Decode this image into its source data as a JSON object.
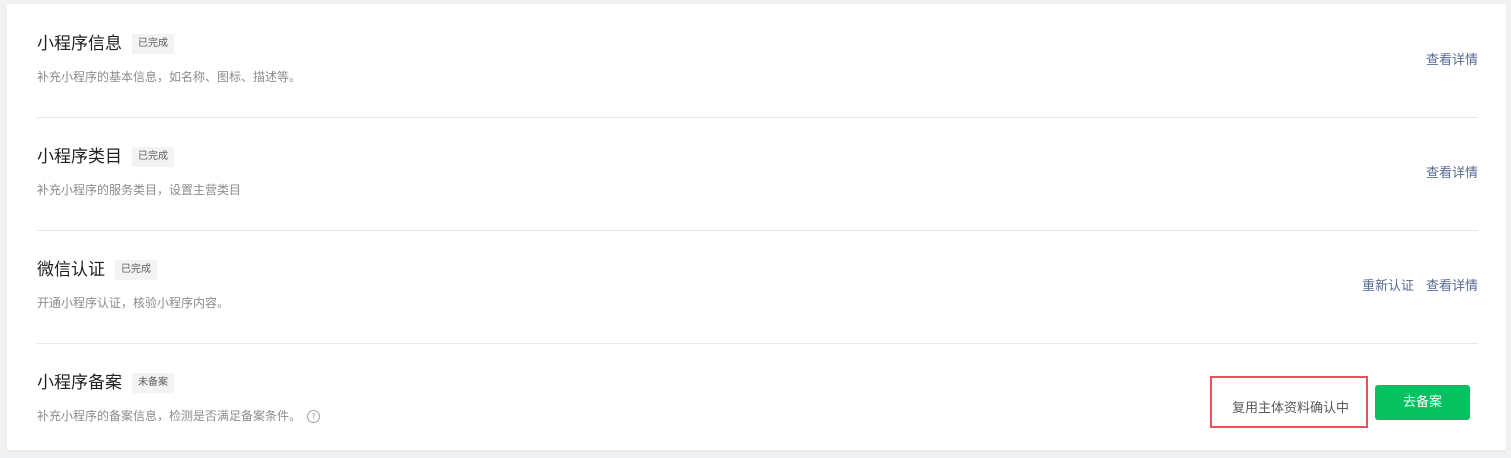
{
  "rows": [
    {
      "title": "小程序信息",
      "badge": "已完成",
      "desc": "补充小程序的基本信息，如名称、图标、描述等。",
      "actions": [
        "查看详情"
      ]
    },
    {
      "title": "小程序类目",
      "badge": "已完成",
      "desc": "补充小程序的服务类目，设置主营类目",
      "actions": [
        "查看详情"
      ]
    },
    {
      "title": "微信认证",
      "badge": "已完成",
      "desc": "开通小程序认证，核验小程序内容。",
      "actions": [
        "重新认证",
        "查看详情"
      ]
    },
    {
      "title": "小程序备案",
      "badge": "未备案",
      "desc": "补充小程序的备案信息，检测是否满足备案条件。",
      "help_icon": "question-circle-icon",
      "status_text": "复用主体资料确认中",
      "primary_button": "去备案"
    }
  ],
  "colors": {
    "link": "#576b95",
    "primary": "#07c160",
    "highlight_border": "#e5545b"
  }
}
